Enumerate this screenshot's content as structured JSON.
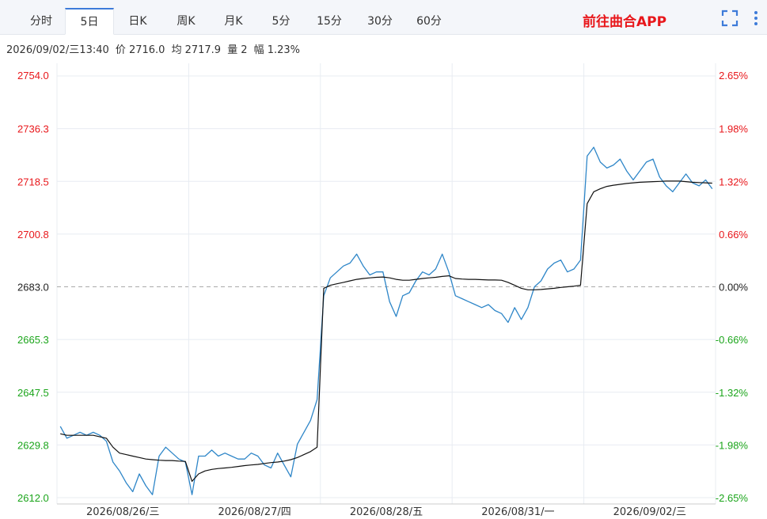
{
  "tabs": [
    {
      "label": "分时",
      "active": false
    },
    {
      "label": "5日",
      "active": true
    },
    {
      "label": "日K",
      "active": false
    },
    {
      "label": "周K",
      "active": false
    },
    {
      "label": "月K",
      "active": false
    },
    {
      "label": "5分",
      "active": false
    },
    {
      "label": "15分",
      "active": false
    },
    {
      "label": "30分",
      "active": false
    },
    {
      "label": "60分",
      "active": false
    }
  ],
  "promo_link": "前往曲合APP",
  "icons": [
    "fullscreen-icon",
    "more-vertical-icon"
  ],
  "info": {
    "datetime": "2026/09/02/三13:40",
    "price_label": "价",
    "price": "2716.0",
    "avg_label": "均",
    "avg": "2717.9",
    "volume_label": "量",
    "volume": "2",
    "amplitude_label": "幅",
    "amplitude": "1.23%"
  },
  "colors": {
    "up": "#e8171b",
    "down": "#1ba51b",
    "neutral": "#222222",
    "price_line": "#2e86c8",
    "avg_line": "#111111",
    "grid": "#e8ecf2"
  },
  "chart_data": {
    "type": "line",
    "reference_price": 2683.0,
    "ylim": [
      2612.0,
      2754.0
    ],
    "y_ticks_left": [
      "2754.0",
      "2736.3",
      "2718.5",
      "2700.8",
      "2683.0",
      "2665.3",
      "2647.5",
      "2629.8",
      "2612.0"
    ],
    "y_ticks_right": [
      "2.65%",
      "1.98%",
      "1.32%",
      "0.66%",
      "0.00%",
      "-0.66%",
      "-1.32%",
      "-1.98%",
      "-2.65%"
    ],
    "days": [
      "2026/08/26/三",
      "2026/08/27/四",
      "2026/08/28/五",
      "2026/08/31/一",
      "2026/09/02/三"
    ],
    "series": [
      {
        "key": "price",
        "values": [
          [
            2636,
            2632,
            2633,
            2634,
            2633,
            2634,
            2633,
            2631,
            2624,
            2621,
            2617,
            2614,
            2620,
            2616,
            2613,
            2626,
            2629,
            2627,
            2625,
            2624
          ],
          [
            2613,
            2626,
            2626,
            2628,
            2626,
            2627,
            2626,
            2625,
            2625,
            2627,
            2626,
            2623,
            2622,
            2627,
            2623,
            2619,
            2630,
            2634,
            2638,
            2645
          ],
          [
            2680,
            2686,
            2688,
            2690,
            2691,
            2694,
            2690,
            2687,
            2688,
            2688,
            2678,
            2673,
            2680,
            2681,
            2685,
            2688,
            2687,
            2689,
            2694,
            2688
          ],
          [
            2680,
            2679,
            2678,
            2677,
            2676,
            2677,
            2675,
            2674,
            2671,
            2676,
            2672,
            2676,
            2683,
            2685,
            2689,
            2691,
            2692,
            2688,
            2689,
            2692
          ],
          [
            2727,
            2730,
            2725,
            2723,
            2724,
            2726,
            2722,
            2719,
            2722,
            2725,
            2726,
            2720,
            2717,
            2715,
            2718,
            2721,
            2718,
            2717,
            2719,
            2716
          ]
        ]
      },
      {
        "key": "average",
        "values": [
          [
            2633.5,
            2633.0,
            2633.0,
            2633.0,
            2633.0,
            2633.0,
            2632.5,
            2632.0,
            2629.0,
            2627.0,
            2626.5,
            2626.0,
            2625.5,
            2625.0,
            2624.8,
            2624.6,
            2624.5,
            2624.5,
            2624.3,
            2624.2
          ],
          [
            2617.5,
            2620.0,
            2621.0,
            2621.5,
            2621.8,
            2622.0,
            2622.2,
            2622.5,
            2622.8,
            2623.0,
            2623.2,
            2623.5,
            2623.8,
            2624.0,
            2624.3,
            2624.8,
            2625.5,
            2626.5,
            2627.5,
            2629.0
          ],
          [
            2682.5,
            2683.5,
            2684.0,
            2684.5,
            2685.0,
            2685.5,
            2685.8,
            2686.0,
            2686.2,
            2686.3,
            2686.0,
            2685.5,
            2685.2,
            2685.2,
            2685.5,
            2685.8,
            2686.0,
            2686.2,
            2686.5,
            2686.7
          ],
          [
            2685.8,
            2685.6,
            2685.5,
            2685.5,
            2685.4,
            2685.3,
            2685.3,
            2685.2,
            2684.5,
            2683.5,
            2682.5,
            2682.0,
            2682.0,
            2682.1,
            2682.3,
            2682.5,
            2682.8,
            2683.0,
            2683.2,
            2683.5
          ],
          [
            2711.0,
            2715.0,
            2716.0,
            2716.8,
            2717.2,
            2717.5,
            2717.8,
            2718.0,
            2718.2,
            2718.3,
            2718.4,
            2718.5,
            2718.6,
            2718.6,
            2718.6,
            2718.4,
            2718.2,
            2718.1,
            2718.0,
            2717.9
          ]
        ]
      }
    ]
  }
}
